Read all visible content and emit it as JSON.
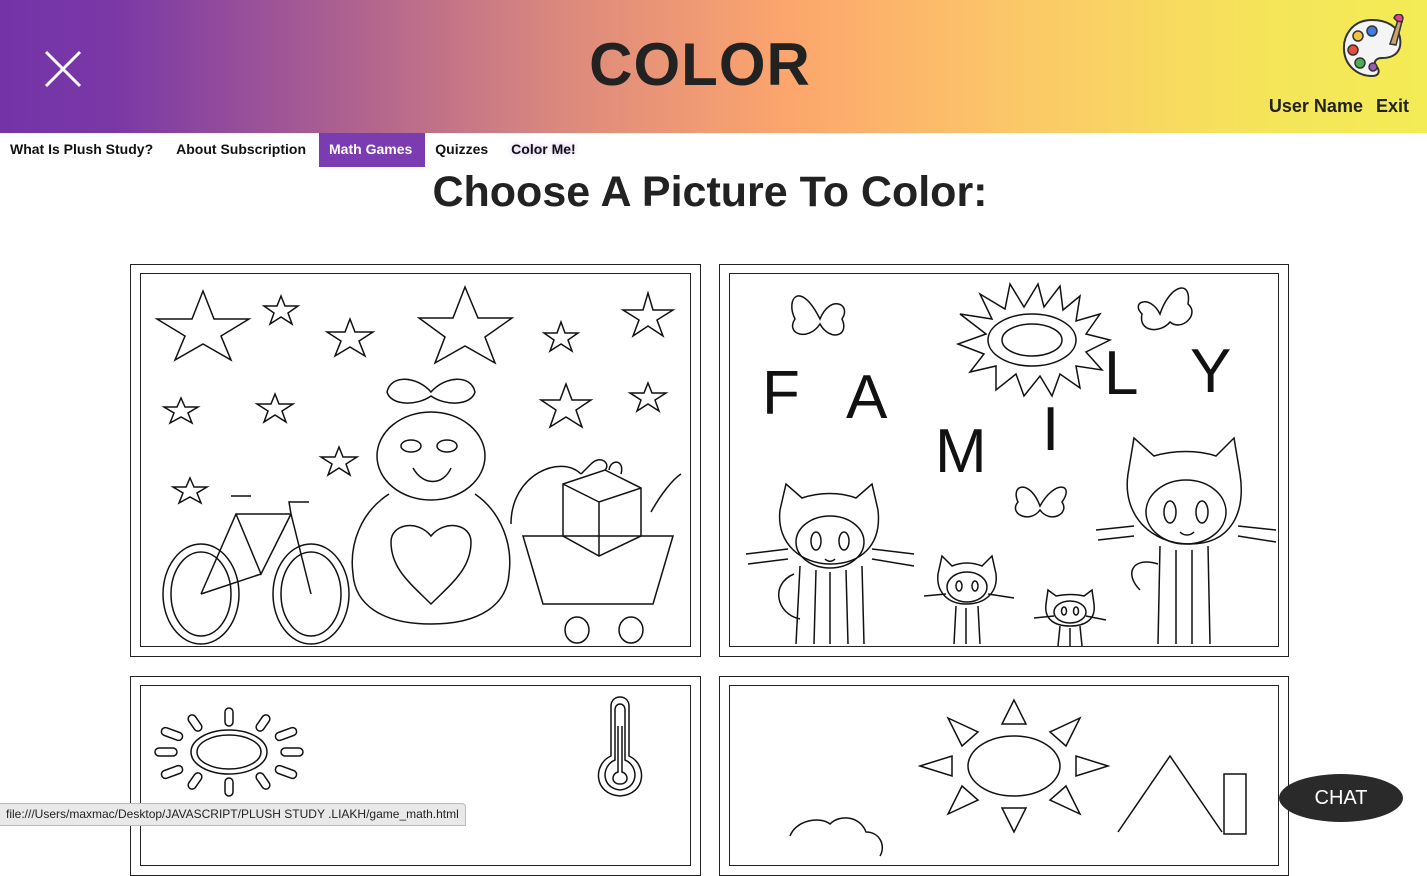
{
  "header": {
    "title": "COLOR",
    "close_icon": "close-icon",
    "palette_icon": "palette-icon",
    "user_name": "User Name",
    "exit_label": "Exit"
  },
  "nav": {
    "items": [
      {
        "label": "What Is Plush Study?"
      },
      {
        "label": "About Subscription"
      },
      {
        "label": "Math Games"
      },
      {
        "label": "Quizzes"
      },
      {
        "label": "Color Me!"
      }
    ],
    "active_index": 2
  },
  "main": {
    "heading": "Choose A Picture To Color:",
    "cards": [
      {
        "name": "stars-bear-picture"
      },
      {
        "name": "family-cats-picture",
        "letters": [
          "F",
          "A",
          "M",
          "I",
          "L",
          "Y"
        ]
      },
      {
        "name": "sun-thermometer-picture"
      },
      {
        "name": "sun-house-picture"
      }
    ]
  },
  "statusbar": {
    "url": "file:///Users/maxmac/Desktop/JAVASCRIPT/PLUSH STUDY .LIAKH/game_math.html"
  },
  "chat": {
    "label": "CHAT"
  },
  "colors": {
    "accent": "#7a3cb0",
    "gradient_start": "#7434a8",
    "gradient_mid": "#fca56d",
    "gradient_end": "#f3ec55"
  }
}
